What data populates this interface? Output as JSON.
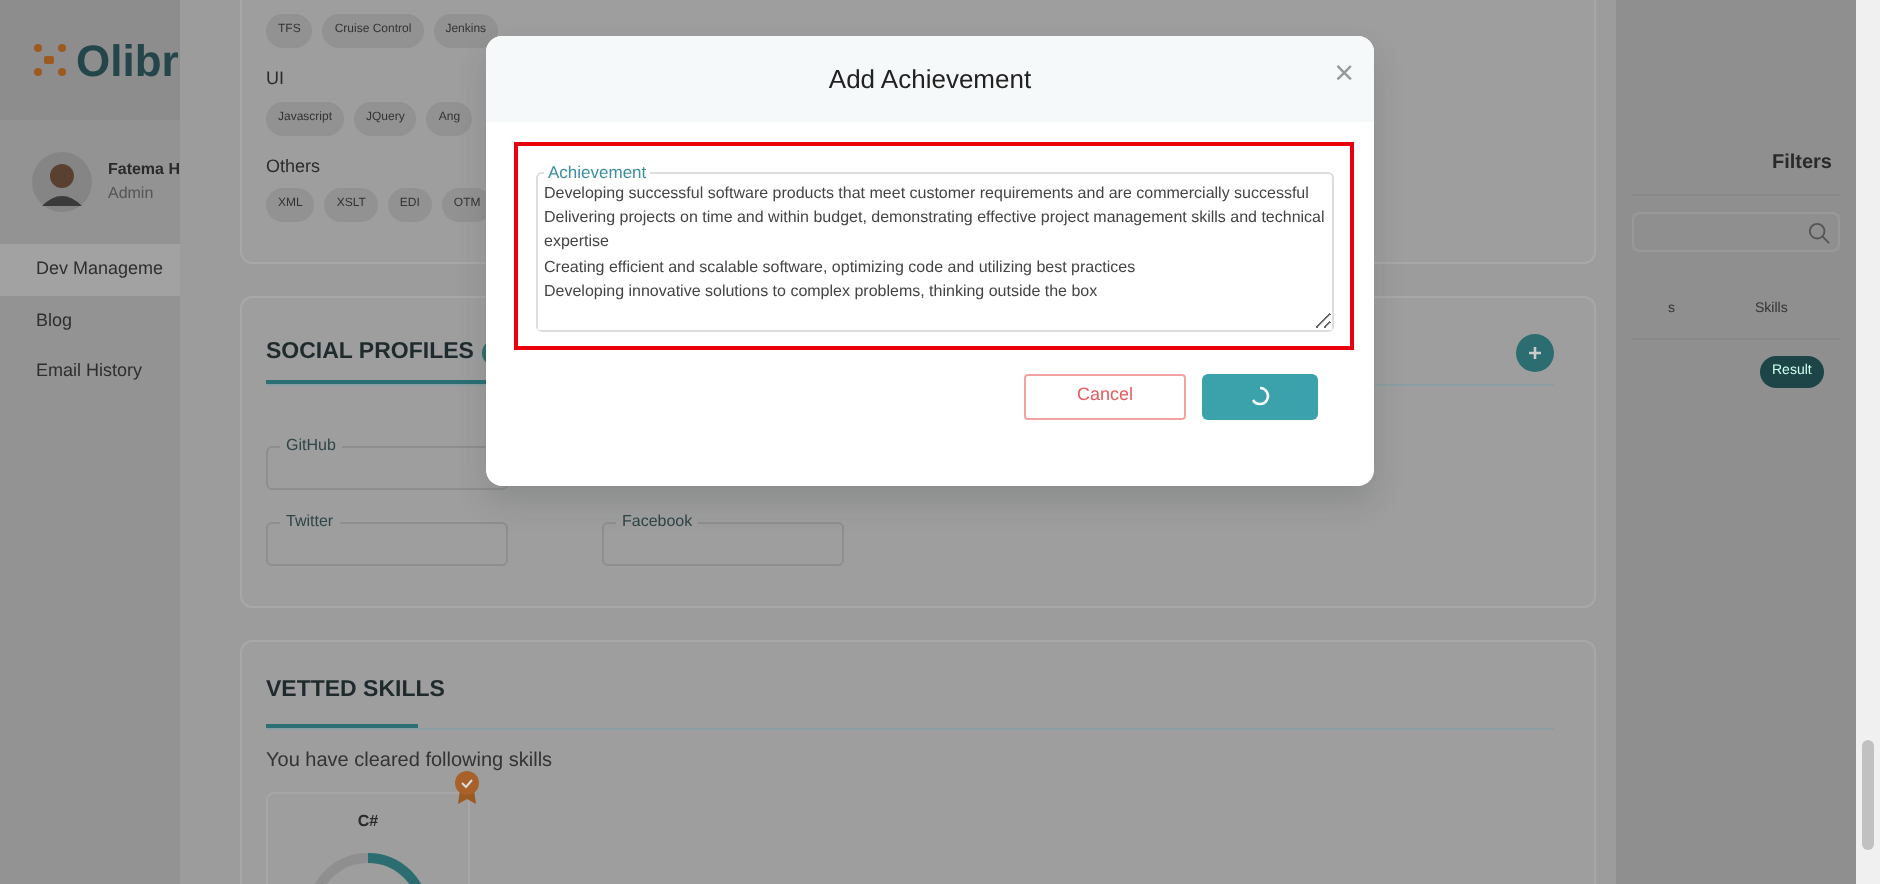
{
  "sidebar": {
    "logo": "Olibr",
    "user": {
      "name": "Fatema H",
      "role": "Admin"
    },
    "items": [
      {
        "label": "Dev Manageme",
        "selected": true
      },
      {
        "label": "Blog",
        "selected": false
      },
      {
        "label": "Email History",
        "selected": false
      }
    ]
  },
  "skills_card": {
    "groups": [
      {
        "tags": [
          "TFS",
          "Cruise Control",
          "Jenkins"
        ]
      },
      {
        "title": "UI",
        "tags": [
          "Javascript",
          "JQuery",
          "Ang"
        ]
      },
      {
        "title": "Others",
        "tags": [
          "XML",
          "XSLT",
          "EDI",
          "OTM"
        ]
      }
    ]
  },
  "social_profiles": {
    "title": "SOCIAL PROFILES",
    "fields": [
      {
        "label": "GitHub"
      },
      {
        "label": "Twitter"
      },
      {
        "label": "Facebook"
      }
    ]
  },
  "vetted_skills": {
    "title": "VETTED SKILLS",
    "note": "You have cleared following skills",
    "skills": [
      {
        "name": "C#"
      }
    ]
  },
  "filters": {
    "title": "Filters",
    "columns": [
      "s",
      "Skills"
    ],
    "row_button": "Result"
  },
  "modal": {
    "title": "Add Achievement",
    "close": "×",
    "field_label": "Achievement",
    "value": "Developing successful software products that meet customer requirements and are commercially successful\nDelivering projects on time and within budget, demonstrating effective project management skills and technical expertise\nCreating efficient and scalable software, optimizing code and utilizing best practices\nDeveloping innovative solutions to complex problems, thinking outside the box",
    "cancel": "Cancel",
    "saving": true
  }
}
